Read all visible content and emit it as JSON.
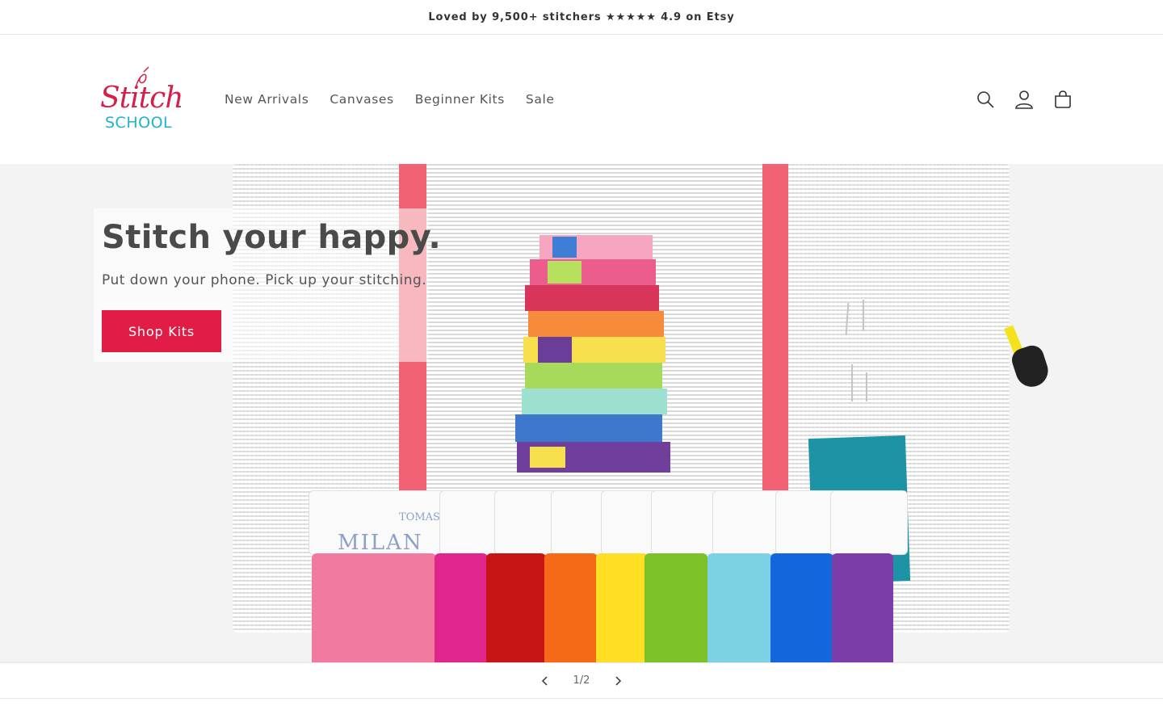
{
  "announcement": {
    "text": "Loved by 9,500+ stitchers ★★★★★ 4.9 on Etsy"
  },
  "logo": {
    "script_text": "Stitch",
    "school_text": "SCHOOL"
  },
  "nav": {
    "items": [
      {
        "label": "New Arrivals"
      },
      {
        "label": "Canvases"
      },
      {
        "label": "Beginner Kits"
      },
      {
        "label": "Sale"
      }
    ]
  },
  "header_icons": [
    "search-icon",
    "account-icon",
    "cart-icon"
  ],
  "hero": {
    "title": "Stitch your happy.",
    "subtitle": "Put down your phone. Pick up your stitching.",
    "cta_label": "Shop Kits",
    "thread_brand": "TOMAS",
    "thread_name": "MILAN"
  },
  "slider": {
    "counter": "1/2"
  },
  "colors": {
    "brand_red": "#e21d45",
    "logo_teal": "#22b2c9",
    "text_dark": "#333333"
  }
}
